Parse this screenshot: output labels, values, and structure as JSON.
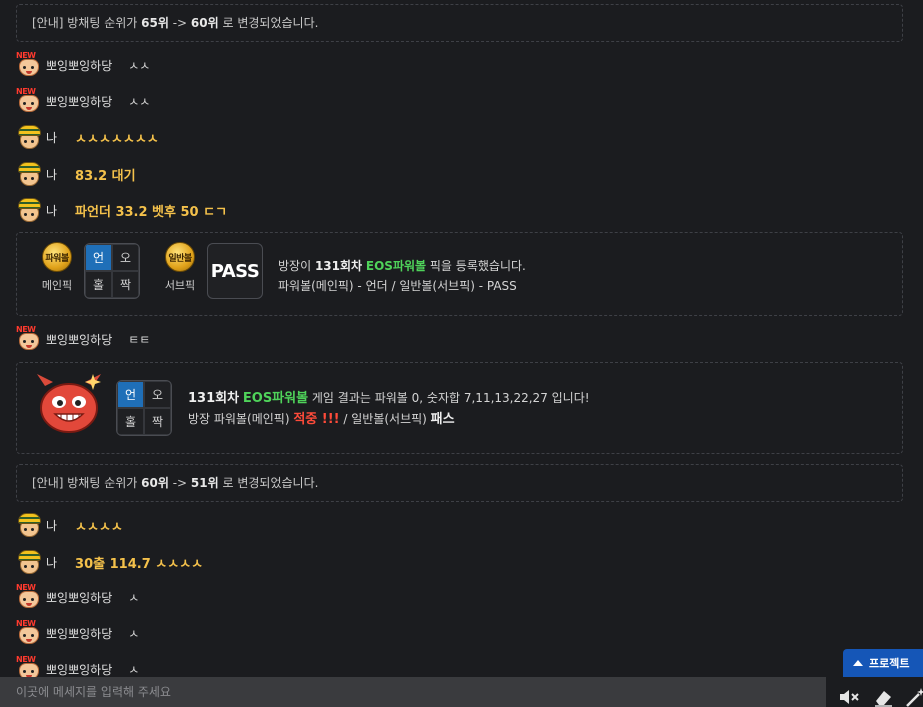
{
  "chat": {
    "notice1": {
      "prefix": "[안내] 방채팅 순위가 ",
      "from": "65위",
      "arrow": " -> ",
      "to": "60위",
      "suffix": " 로 변경되었습니다."
    },
    "messages": [
      {
        "nick": "뽀잉뽀잉하당",
        "text": "ㅅㅅ"
      },
      {
        "nick": "뽀잉뽀잉하당",
        "text": "ㅅㅅ"
      },
      {
        "nick": "나",
        "text": "ㅅㅅㅅㅅㅅㅅㅅ"
      },
      {
        "nick": "나",
        "text": "83.2 대기"
      },
      {
        "nick": "나",
        "text": "파언더 33.2 벳후 50 ㄷㄱ"
      }
    ],
    "pick_card": {
      "main_ball": "파워볼",
      "main_label": "메인픽",
      "grid": [
        "언",
        "오",
        "홀",
        "짝"
      ],
      "sub_ball": "일반볼",
      "sub_label": "서브픽",
      "pass": "PASS",
      "line1_a": "방장이 ",
      "line1_round": "131회차",
      "line1_space": " ",
      "line1_game": "EOS파워볼",
      "line1_b": " 픽을 등록했습니다.",
      "line2": "파워볼(메인픽) - 언더 / 일반볼(서브픽) - PASS"
    },
    "msg_after_pick": {
      "nick": "뽀잉뽀잉하당",
      "text": "ㅌㅌ"
    },
    "result_card": {
      "grid": [
        "언",
        "오",
        "홀",
        "짝"
      ],
      "round": "131회차",
      "game": "EOS파워볼",
      "line1_b": " 게임 결과는 파워볼 0, 숫자합 7,11,13,22,27 입니다!",
      "line2_a": "방장 파워볼(메인픽) ",
      "hit": "적중 !!!",
      "line2_b": " / 일반볼(서브픽) ",
      "pass": "패스"
    },
    "notice2": {
      "prefix": "[안내] 방채팅 순위가 ",
      "from": "60위",
      "arrow": " -> ",
      "to": "51위",
      "suffix": " 로 변경되었습니다."
    },
    "messages2": [
      {
        "nick": "나",
        "text": "ㅅㅅㅅㅅ"
      },
      {
        "nick": "나",
        "text": "30출 114.7 ㅅㅅㅅㅅ"
      },
      {
        "nick": "뽀잉뽀잉하당",
        "text": "ㅅ"
      },
      {
        "nick": "뽀잉뽀잉하당",
        "text": "ㅅ"
      },
      {
        "nick": "뽀잉뽀잉하당",
        "text": "ㅅ"
      }
    ],
    "avatar_new_tag": "NEW"
  },
  "input": {
    "placeholder": "이곳에 메세지를 입력해 주세요"
  },
  "project_button": {
    "label": "프로젝트"
  },
  "icons": {
    "mute": "mute-speaker-icon",
    "eraser": "eraser-icon",
    "magic": "magic-wand-icon"
  },
  "colors": {
    "accent_blue": "#1f6fb8",
    "my_text": "#f4c14b",
    "eos_green": "#4fd35a",
    "hit_red": "#ff4b3a"
  }
}
